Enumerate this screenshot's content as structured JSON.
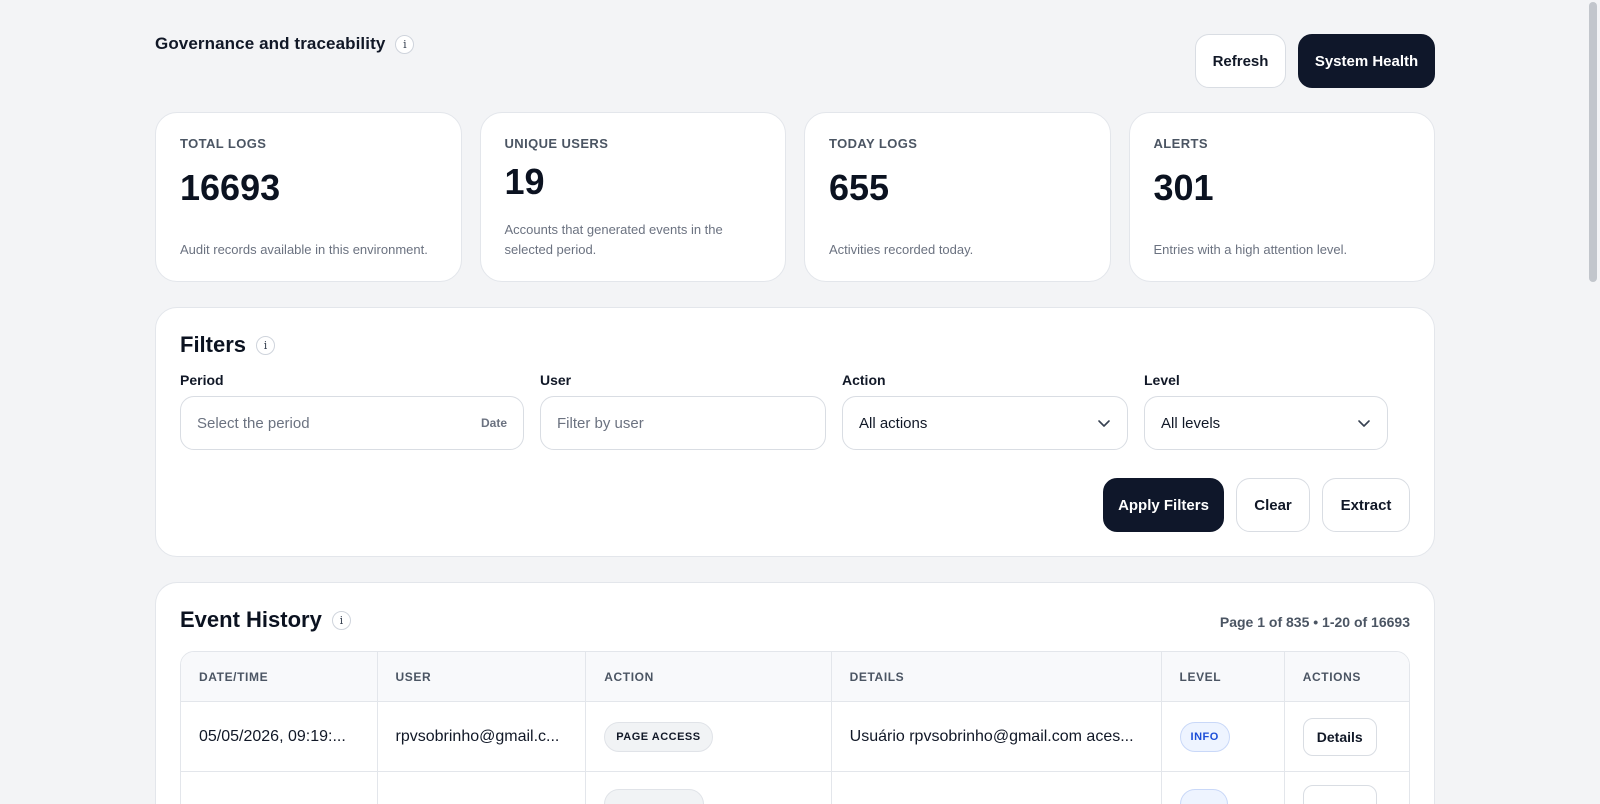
{
  "header": {
    "title": "Governance and traceability",
    "info": "i",
    "refresh_label": "Refresh",
    "health_label": "System Health"
  },
  "stats": [
    {
      "label": "TOTAL LOGS",
      "value": "16693",
      "desc": "Audit records available in this environment."
    },
    {
      "label": "UNIQUE USERS",
      "value": "19",
      "desc": "Accounts that generated events in the selected period."
    },
    {
      "label": "TODAY LOGS",
      "value": "655",
      "desc": "Activities recorded today."
    },
    {
      "label": "ALERTS",
      "value": "301",
      "desc": "Entries with a high attention level."
    }
  ],
  "filters": {
    "title": "Filters",
    "info": "i",
    "period": {
      "label": "Period",
      "placeholder": "Select the period",
      "hint": "Date"
    },
    "user": {
      "label": "User",
      "placeholder": "Filter by user"
    },
    "action": {
      "label": "Action",
      "value": "All actions"
    },
    "level": {
      "label": "Level",
      "value": "All levels"
    },
    "apply_label": "Apply Filters",
    "clear_label": "Clear",
    "extract_label": "Extract"
  },
  "history": {
    "title": "Event History",
    "info": "i",
    "page_info": "Page 1 of 835 • 1-20 of 16693",
    "columns": [
      "DATE/TIME",
      "USER",
      "ACTION",
      "DETAILS",
      "LEVEL",
      "ACTIONS"
    ],
    "rows": [
      {
        "datetime": "05/05/2026, 09:19:...",
        "user": "rpvsobrinho@gmail.c...",
        "action": "PAGE ACCESS",
        "details": "Usuário rpvsobrinho@gmail.com aces...",
        "level": "INFO",
        "button": "Details"
      }
    ]
  }
}
